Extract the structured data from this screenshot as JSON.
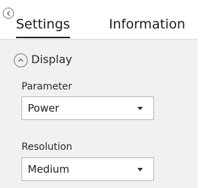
{
  "header": {
    "back_icon": "chevron-left-icon",
    "tabs": [
      {
        "label": "Settings",
        "active": true
      },
      {
        "label": "Information",
        "active": false
      }
    ]
  },
  "section": {
    "title": "Display",
    "toggle_icon": "chevron-up-icon",
    "expanded": true
  },
  "fields": [
    {
      "label": "Parameter",
      "value": "Power"
    },
    {
      "label": "Resolution",
      "value": "Medium"
    }
  ],
  "colors": {
    "panel_background": "#f1f1f1",
    "header_background": "#ffffff",
    "border": "#b5b5b5"
  }
}
